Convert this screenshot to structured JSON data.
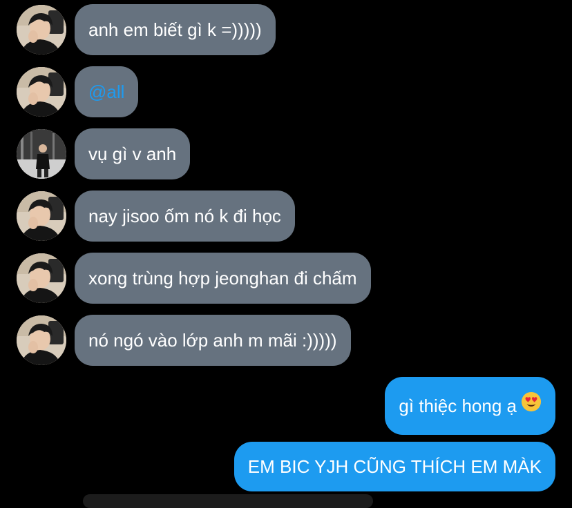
{
  "messages": [
    {
      "side": "in",
      "text": "anh em biết gì k =)))))"
    },
    {
      "side": "in",
      "text": "@all"
    },
    {
      "side": "in",
      "text": "vụ gì v anh"
    },
    {
      "side": "in",
      "text": "nay jisoo ốm nó k đi học"
    },
    {
      "side": "in",
      "text": "xong trùng hợp jeonghan đi chấm"
    },
    {
      "side": "in",
      "text": "nó ngó vào lớp anh m mãi :)))))"
    },
    {
      "side": "out",
      "text": "gì thiệc hong ạ",
      "emoji": "heart-eyes-emoji-icon"
    },
    {
      "side": "out",
      "text": "EM BIC YJH CŨNG THÍCH EM MÀK"
    }
  ],
  "colors": {
    "background": "#000000",
    "incoming_bubble": "#66727f",
    "outgoing_bubble": "#1d9bf0",
    "mention": "#1d9bf0"
  }
}
